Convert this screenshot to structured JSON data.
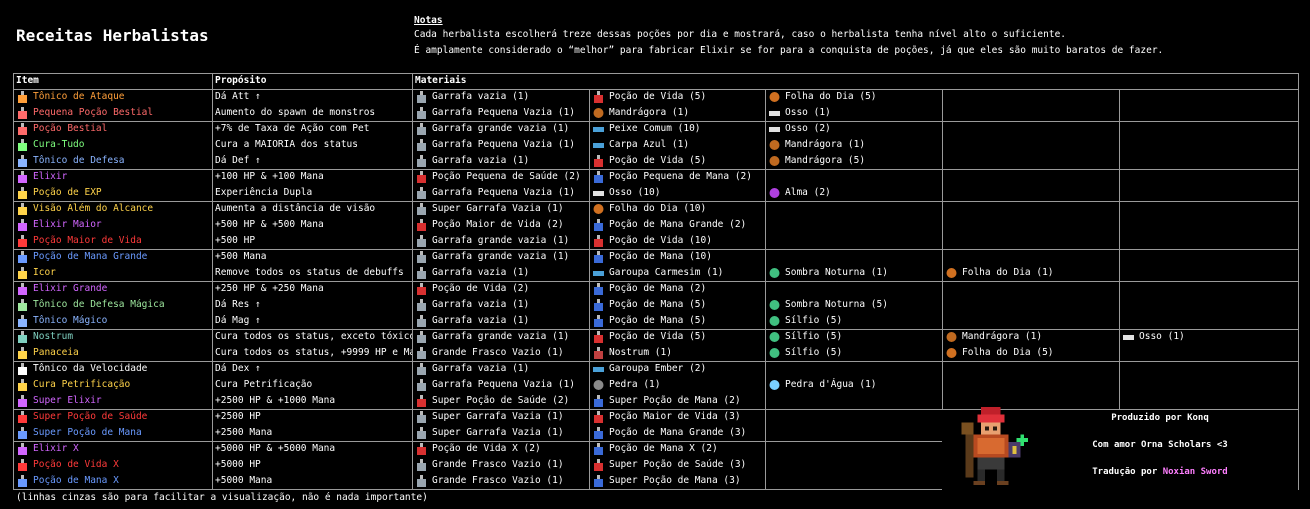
{
  "title": "Receitas Herbalistas",
  "notes": {
    "heading": "Notas",
    "line1": "Cada herbalista escolherá treze dessas poções por dia e mostrará, caso o herbalista tenha nível alto o suficiente.",
    "line2": "É amplamente considerado o “melhor” para fabricar Elixir se for para a conquista de poções, já que eles são muito baratos de fazer."
  },
  "headers": {
    "item": "Item",
    "purpose": "Propósito",
    "materials": "Materiais"
  },
  "rows": [
    {
      "item": "Tônico de Ataque",
      "color": "#ff9f3a",
      "icon": "potion-icon",
      "purpose": "Dá Att ↑",
      "m": [
        {
          "t": "Garrafa vazia (1)",
          "i": "bottle-icon"
        },
        {
          "t": "Poção de Vida (5)",
          "i": "red-potion-icon"
        },
        {
          "t": "Folha do Dia (5)",
          "i": "leaf-icon"
        }
      ]
    },
    {
      "item": "Pequena Poção Bestial",
      "color": "#ff6a6a",
      "icon": "potion-icon",
      "purpose": "Aumento do spawn de monstros",
      "m": [
        {
          "t": "Garrafa Pequena Vazia (1)",
          "i": "bottle-icon"
        },
        {
          "t": "Mandrágora (1)",
          "i": "root-icon"
        },
        {
          "t": "Osso (1)",
          "i": "bone-icon"
        }
      ]
    },
    {
      "item": "Poção Bestial",
      "color": "#ff6a6a",
      "icon": "potion-icon",
      "purpose": "+7% de Taxa de Ação com Pet",
      "m": [
        {
          "t": "Garrafa grande vazia (1)",
          "i": "bottle-icon"
        },
        {
          "t": "Peixe Comum (10)",
          "i": "fish-icon"
        },
        {
          "t": "Osso (2)",
          "i": "bone-icon"
        }
      ]
    },
    {
      "item": "Cura-Tudo",
      "color": "#7fff7f",
      "icon": "potion-icon",
      "purpose": "Cura a MAIORIA dos status",
      "m": [
        {
          "t": "Garrafa Pequena Vazia (1)",
          "i": "bottle-icon"
        },
        {
          "t": "Carpa Azul (1)",
          "i": "fish-icon"
        },
        {
          "t": "Mandrágora (1)",
          "i": "root-icon"
        }
      ]
    },
    {
      "item": "Tônico de Defesa",
      "color": "#8ab4ff",
      "icon": "potion-icon",
      "purpose": "Dá Def ↑",
      "m": [
        {
          "t": "Garrafa vazia (1)",
          "i": "bottle-icon"
        },
        {
          "t": "Poção de Vida (5)",
          "i": "red-potion-icon"
        },
        {
          "t": "Mandrágora (5)",
          "i": "root-icon"
        }
      ]
    },
    {
      "item": "Elixir",
      "color": "#d266ff",
      "icon": "potion-icon",
      "purpose": "+100 HP & +100 Mana",
      "m": [
        {
          "t": "Poção Pequena de Saúde (2)",
          "i": "red-potion-icon"
        },
        {
          "t": "Poção Pequena de Mana (2)",
          "i": "blue-potion-icon"
        }
      ]
    },
    {
      "item": "Poção de EXP",
      "color": "#ffd34a",
      "icon": "potion-icon",
      "purpose": "Experiência Dupla",
      "m": [
        {
          "t": "Garrafa Pequena Vazia (1)",
          "i": "bottle-icon"
        },
        {
          "t": "Osso (10)",
          "i": "bone-icon"
        },
        {
          "t": "Alma (2)",
          "i": "soul-icon"
        }
      ]
    },
    {
      "item": "Visão Além do Alcance",
      "color": "#ffd34a",
      "icon": "potion-icon",
      "purpose": "Aumenta a distância de visão",
      "m": [
        {
          "t": "Super Garrafa Vazia (1)",
          "i": "bottle-icon"
        },
        {
          "t": "Folha do Dia (10)",
          "i": "leaf-icon"
        }
      ]
    },
    {
      "item": "Elixir Maior",
      "color": "#d266ff",
      "icon": "potion-icon",
      "purpose": "+500 HP & +500 Mana",
      "m": [
        {
          "t": "Poção Maior de Vida (2)",
          "i": "red-potion-icon"
        },
        {
          "t": "Poção de Mana Grande (2)",
          "i": "blue-potion-icon"
        }
      ]
    },
    {
      "item": "Poção Maior de Vida",
      "color": "#ff3a3a",
      "icon": "potion-icon",
      "purpose": "+500 HP",
      "m": [
        {
          "t": "Garrafa grande vazia (1)",
          "i": "bottle-icon"
        },
        {
          "t": "Poção de Vida (10)",
          "i": "red-potion-icon"
        }
      ]
    },
    {
      "item": "Poção de Mana Grande",
      "color": "#6a9aff",
      "icon": "potion-icon",
      "purpose": "+500 Mana",
      "m": [
        {
          "t": "Garrafa grande vazia (1)",
          "i": "bottle-icon"
        },
        {
          "t": "Poção de Mana (10)",
          "i": "blue-potion-icon"
        }
      ]
    },
    {
      "item": "Icor",
      "color": "#ffd34a",
      "icon": "potion-icon",
      "purpose": "Remove todos os status de debuffs",
      "m": [
        {
          "t": "Garrafa vazia (1)",
          "i": "bottle-icon"
        },
        {
          "t": "Garoupa Carmesim (1)",
          "i": "fish-icon"
        },
        {
          "t": "Sombra Noturna (1)",
          "i": "herb-icon"
        },
        {
          "t": "Folha do Dia (1)",
          "i": "leaf-icon"
        }
      ]
    },
    {
      "item": "Elixir Grande",
      "color": "#d266ff",
      "icon": "potion-icon",
      "purpose": "+250 HP & +250 Mana",
      "m": [
        {
          "t": "Poção de Vida (2)",
          "i": "red-potion-icon"
        },
        {
          "t": "Poção de Mana (2)",
          "i": "blue-potion-icon"
        }
      ]
    },
    {
      "item": "Tônico de Defesa Mágica",
      "color": "#9fe89f",
      "icon": "potion-icon",
      "purpose": "Dá Res ↑",
      "m": [
        {
          "t": "Garrafa vazia (1)",
          "i": "bottle-icon"
        },
        {
          "t": "Poção de Mana (5)",
          "i": "blue-potion-icon"
        },
        {
          "t": "Sombra Noturna (5)",
          "i": "herb-icon"
        }
      ]
    },
    {
      "item": "Tônico Mágico",
      "color": "#8ab4ff",
      "icon": "potion-icon",
      "purpose": "Dá Mag ↑",
      "m": [
        {
          "t": "Garrafa vazia (1)",
          "i": "bottle-icon"
        },
        {
          "t": "Poção de Mana (5)",
          "i": "blue-potion-icon"
        },
        {
          "t": "Sílfio (5)",
          "i": "herb-icon"
        }
      ]
    },
    {
      "item": "Nostrum",
      "color": "#7fd0c0",
      "icon": "potion-icon",
      "purpose": "Cura todos os status, exceto tóxico",
      "m": [
        {
          "t": "Garrafa grande vazia (1)",
          "i": "bottle-icon"
        },
        {
          "t": "Poção de Vida (5)",
          "i": "red-potion-icon"
        },
        {
          "t": "Sílfio (5)",
          "i": "herb-icon"
        },
        {
          "t": "Mandrágora (1)",
          "i": "root-icon"
        },
        {
          "t": "Osso (1)",
          "i": "bone-icon"
        }
      ]
    },
    {
      "item": "Panaceia",
      "color": "#ffd34a",
      "icon": "potion-icon",
      "purpose": "Cura todos os status, +9999 HP e Mana",
      "m": [
        {
          "t": "Grande Frasco Vazio (1)",
          "i": "bottle-icon"
        },
        {
          "t": "Nostrum (1)",
          "i": "potion-icon"
        },
        {
          "t": "Sílfio (5)",
          "i": "herb-icon"
        },
        {
          "t": "Folha do Dia (5)",
          "i": "leaf-icon"
        }
      ]
    },
    {
      "item": "Tônico da Velocidade",
      "color": "#ffffff",
      "icon": "potion-icon",
      "purpose": "Dá Dex ↑",
      "m": [
        {
          "t": "Garrafa vazia (1)",
          "i": "bottle-icon"
        },
        {
          "t": "Garoupa Ember (2)",
          "i": "fish-icon"
        }
      ]
    },
    {
      "item": "Cura Petrificação",
      "color": "#ffd34a",
      "icon": "potion-icon",
      "purpose": "Cura Petrificação",
      "m": [
        {
          "t": "Garrafa Pequena Vazia (1)",
          "i": "bottle-icon"
        },
        {
          "t": "Pedra (1)",
          "i": "stone-icon"
        },
        {
          "t": "Pedra d'Água (1)",
          "i": "gem-icon"
        }
      ]
    },
    {
      "item": "Super Elixir",
      "color": "#d266ff",
      "icon": "potion-icon",
      "purpose": "+2500 HP & +1000 Mana",
      "m": [
        {
          "t": "Super Poção de Saúde (2)",
          "i": "red-potion-icon"
        },
        {
          "t": "Super Poção de Mana (2)",
          "i": "blue-potion-icon"
        }
      ]
    },
    {
      "item": "Super Poção de Saúde",
      "color": "#ff3a3a",
      "icon": "potion-icon",
      "purpose": "+2500 HP",
      "m": [
        {
          "t": "Super Garrafa Vazia (1)",
          "i": "bottle-icon"
        },
        {
          "t": "Poção Maior de Vida (3)",
          "i": "red-potion-icon"
        }
      ]
    },
    {
      "item": "Super Poção de Mana",
      "color": "#6a9aff",
      "icon": "potion-icon",
      "purpose": "+2500 Mana",
      "m": [
        {
          "t": "Super Garrafa Vazia (1)",
          "i": "bottle-icon"
        },
        {
          "t": "Poção de Mana Grande (3)",
          "i": "blue-potion-icon"
        }
      ]
    },
    {
      "item": "Elixir X",
      "color": "#d266ff",
      "icon": "potion-icon",
      "purpose": "+5000 HP & +5000 Mana",
      "m": [
        {
          "t": "Poção de Vida X (2)",
          "i": "red-potion-icon"
        },
        {
          "t": "Poção de Mana X (2)",
          "i": "blue-potion-icon"
        }
      ]
    },
    {
      "item": "Poção de Vida X",
      "color": "#ff3a3a",
      "icon": "potion-icon",
      "purpose": "+5000 HP",
      "m": [
        {
          "t": "Grande Frasco Vazio (1)",
          "i": "bottle-icon"
        },
        {
          "t": "Super Poção de Saúde (3)",
          "i": "red-potion-icon"
        }
      ]
    },
    {
      "item": "Poção de Mana X",
      "color": "#6a9aff",
      "icon": "potion-icon",
      "purpose": "+5000 Mana",
      "m": [
        {
          "t": "Grande Frasco Vazio (1)",
          "i": "bottle-icon"
        },
        {
          "t": "Super Poção de Mana (3)",
          "i": "blue-potion-icon"
        }
      ]
    }
  ],
  "credits": {
    "line1": "Produzido por Konq",
    "line2": "Com amor Orna Scholars <3",
    "line3_prefix": "Tradução por ",
    "line3_name": "Noxian Sword",
    "name_color": "#ff7fff"
  },
  "footer": "(linhas cinzas são para facilitar a visualização, não é nada importante)"
}
